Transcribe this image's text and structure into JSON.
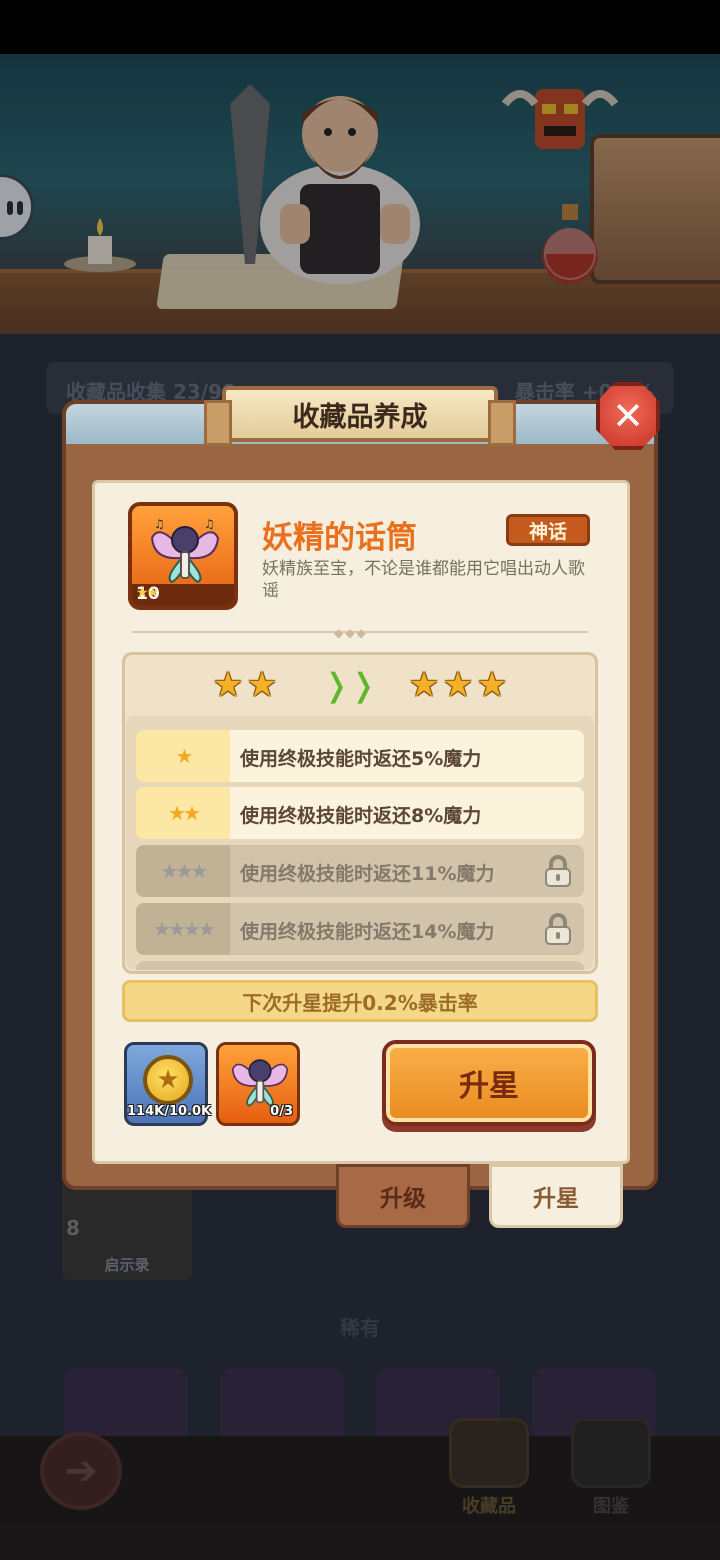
{
  "background": {
    "stats_left": "收藏品收集 23/98",
    "stats_right": "暴击率 +0.6%",
    "card_level": "8",
    "card_label": "启示录",
    "section_label": "稀有"
  },
  "nav": {
    "back_icon": "back-arrow-icon",
    "tabs": [
      {
        "label": "收藏品",
        "icon": "collection-icon"
      },
      {
        "label": "图鉴",
        "icon": "book-icon"
      }
    ]
  },
  "modal": {
    "title": "收藏品养成",
    "close_icon": "close-icon",
    "item": {
      "name": "妖精的话筒",
      "rarity": "神话",
      "description": "妖精族至宝，不论是谁都能用它唱出动人歌谣",
      "level": "10",
      "current_stars": 2,
      "next_stars": 3
    },
    "effects": [
      {
        "stars": 1,
        "text": "使用终极技能时返还5%魔力",
        "locked": false
      },
      {
        "stars": 2,
        "text": "使用终极技能时返还8%魔力",
        "locked": false
      },
      {
        "stars": 3,
        "text": "使用终极技能时返还11%魔力",
        "locked": true
      },
      {
        "stars": 4,
        "text": "使用终极技能时返还14%魔力",
        "locked": true
      }
    ],
    "next_bonus": "下次升星提升0.2%暴击率",
    "costs": [
      {
        "icon": "gold-coin-icon",
        "amount": "114K/10.0K"
      },
      {
        "icon": "fairy-microphone-icon",
        "amount": "0/3"
      }
    ],
    "upgrade_button": "升星",
    "tabs": [
      {
        "label": "升级",
        "active": false
      },
      {
        "label": "升星",
        "active": true
      }
    ]
  },
  "colors": {
    "accent_orange": "#e9701d",
    "mythic_badge": "#c55a1f",
    "upgrade_button": "#f9b04b",
    "star_gold": "#f4b026",
    "arrow_green": "#5cb82e"
  }
}
